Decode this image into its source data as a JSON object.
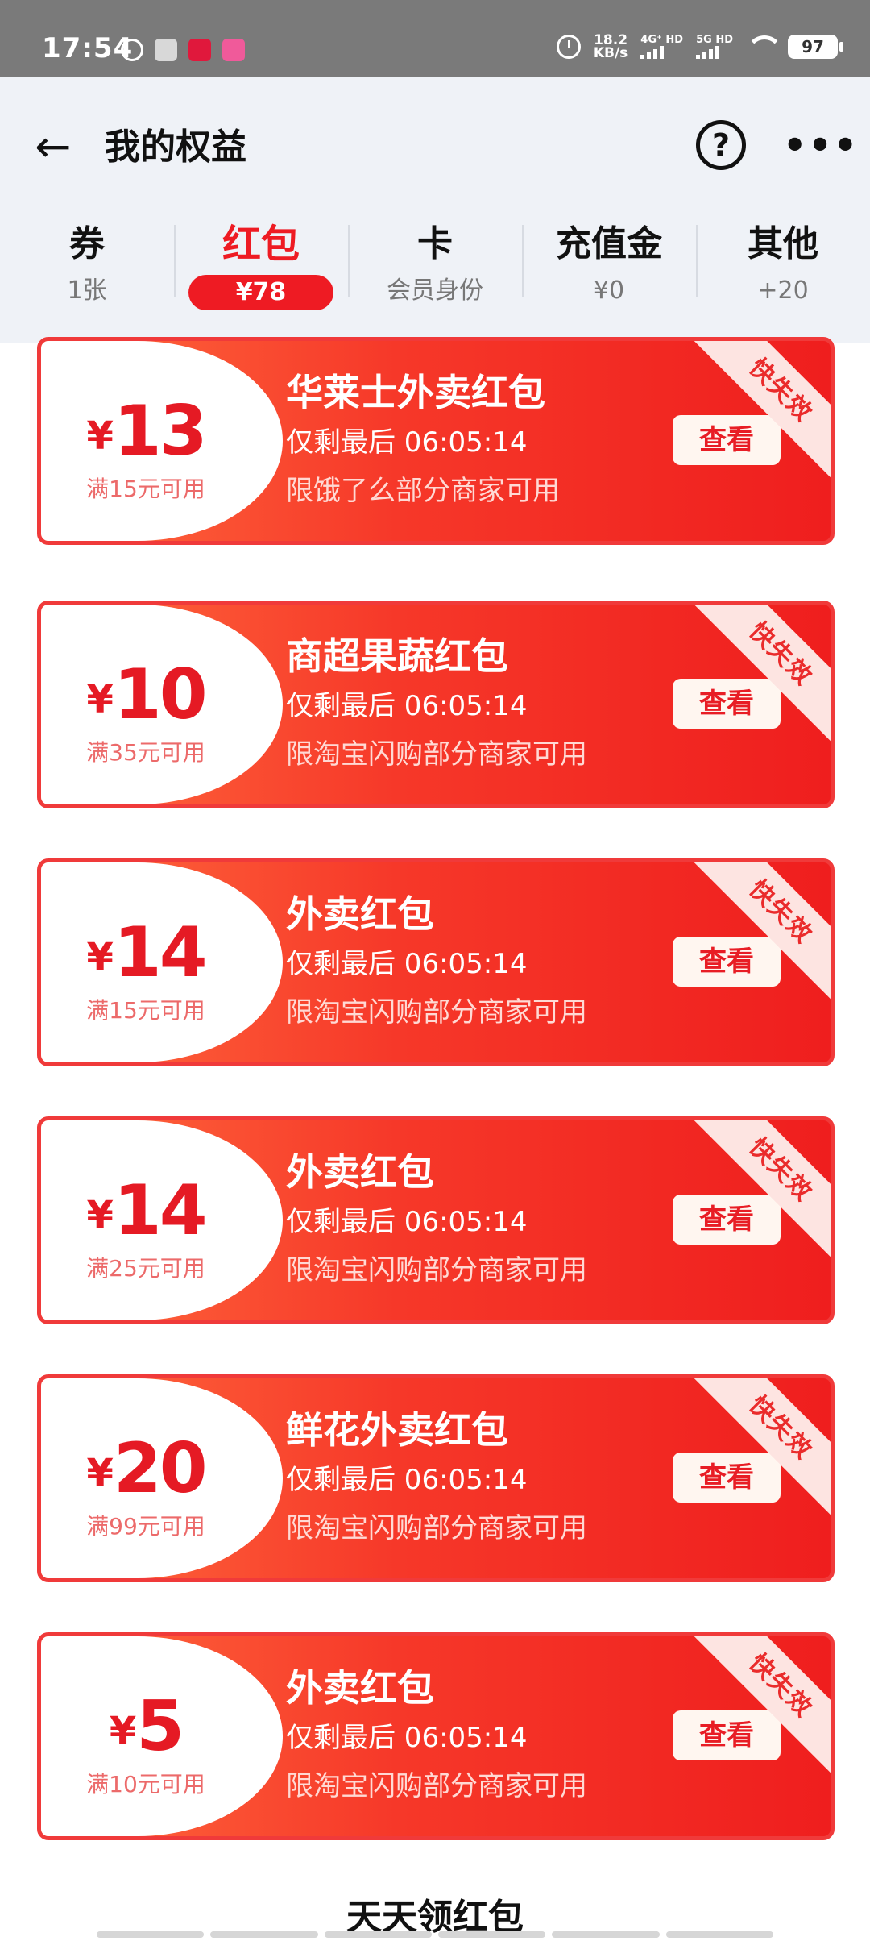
{
  "status": {
    "time": "17:54",
    "speed_value": "18.2",
    "speed_unit": "KB/s",
    "sim1_label": "4G⁺ HD",
    "sim2_label": "5G HD",
    "battery": "97"
  },
  "header": {
    "title": "我的权益"
  },
  "tabs": [
    {
      "label": "券",
      "sub": "1张"
    },
    {
      "label": "红包",
      "sub": "¥78"
    },
    {
      "label": "卡",
      "sub": "会员身份"
    },
    {
      "label": "充值金",
      "sub": "¥0"
    },
    {
      "label": "其他",
      "sub": "+20"
    }
  ],
  "active_tab": 1,
  "coupons": [
    {
      "currency": "¥",
      "amount": "13",
      "condition": "满15元可用",
      "title": "华莱士外卖红包",
      "timer": "仅剩最后 06:05:14",
      "desc": "限饿了么部分商家可用",
      "button": "查看",
      "ribbon": "快失效"
    },
    {
      "currency": "¥",
      "amount": "10",
      "condition": "满35元可用",
      "title": "商超果蔬红包",
      "timer": "仅剩最后 06:05:14",
      "desc": "限淘宝闪购部分商家可用",
      "button": "查看",
      "ribbon": "快失效"
    },
    {
      "currency": "¥",
      "amount": "14",
      "condition": "满15元可用",
      "title": "外卖红包",
      "timer": "仅剩最后 06:05:14",
      "desc": "限淘宝闪购部分商家可用",
      "button": "查看",
      "ribbon": "快失效"
    },
    {
      "currency": "¥",
      "amount": "14",
      "condition": "满25元可用",
      "title": "外卖红包",
      "timer": "仅剩最后 06:05:14",
      "desc": "限淘宝闪购部分商家可用",
      "button": "查看",
      "ribbon": "快失效"
    },
    {
      "currency": "¥",
      "amount": "20",
      "condition": "满99元可用",
      "title": "鲜花外卖红包",
      "timer": "仅剩最后 06:05:14",
      "desc": "限淘宝闪购部分商家可用",
      "button": "查看",
      "ribbon": "快失效"
    },
    {
      "currency": "¥",
      "amount": "5",
      "condition": "满10元可用",
      "title": "外卖红包",
      "timer": "仅剩最后 06:05:14",
      "desc": "限淘宝闪购部分商家可用",
      "button": "查看",
      "ribbon": "快失效"
    }
  ],
  "footer": {
    "title": "天天领红包"
  },
  "icons": {
    "back": "arrow-left-icon",
    "help": "question-circle-icon",
    "more": "more-dots-icon"
  },
  "colors": {
    "accent": "#ee1b23",
    "header_bg": "#eff2f7"
  }
}
